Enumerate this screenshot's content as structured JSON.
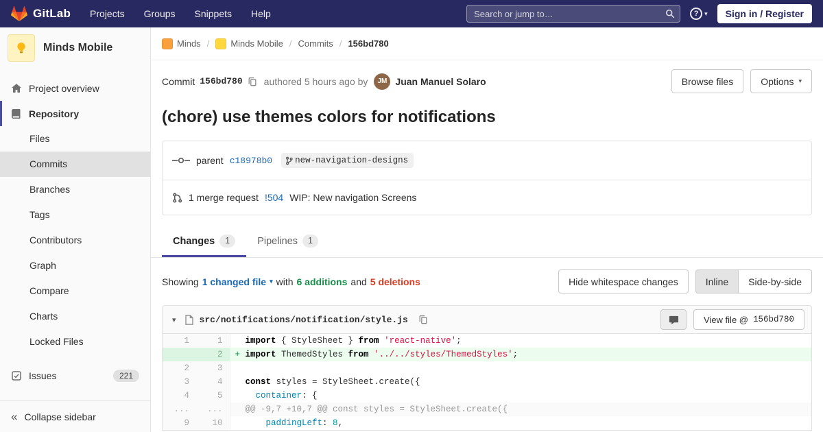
{
  "colors": {
    "navbar_bg": "#292961",
    "accent_indigo": "#4b4ba3",
    "link_blue": "#1b69b6",
    "addition_green": "#168f48",
    "deletion_red": "#db3b21",
    "added_line_bg": "#ecfdf0"
  },
  "navbar": {
    "brand": "GitLab",
    "items": [
      {
        "label": "Projects"
      },
      {
        "label": "Groups"
      },
      {
        "label": "Snippets"
      },
      {
        "label": "Help"
      }
    ],
    "search_placeholder": "Search or jump to…",
    "help_glyph": "?",
    "signin_label": "Sign in / Register"
  },
  "sidebar": {
    "project_name": "Minds Mobile",
    "overview_label": "Project overview",
    "repository_label": "Repository",
    "repo_items": [
      {
        "label": "Files",
        "active": false
      },
      {
        "label": "Commits",
        "active": true
      },
      {
        "label": "Branches",
        "active": false
      },
      {
        "label": "Tags",
        "active": false
      },
      {
        "label": "Contributors",
        "active": false
      },
      {
        "label": "Graph",
        "active": false
      },
      {
        "label": "Compare",
        "active": false
      },
      {
        "label": "Charts",
        "active": false
      },
      {
        "label": "Locked Files",
        "active": false
      }
    ],
    "issues_label": "Issues",
    "issues_count": "221",
    "collapse_label": "Collapse sidebar"
  },
  "breadcrumb": {
    "items": [
      {
        "label": "Minds",
        "avatar": "#f9a03c"
      },
      {
        "label": "Minds Mobile",
        "avatar": "#ffd83d"
      },
      {
        "label": "Commits"
      },
      {
        "label": "156bd780",
        "current": true
      }
    ]
  },
  "commit": {
    "label": "Commit",
    "sha": "156bd780",
    "authored_text": "authored 5 hours ago by",
    "author_initials": "JM",
    "author_name": "Juan Manuel Solaro",
    "browse_files_label": "Browse files",
    "options_label": "Options",
    "title": "(chore) use themes colors for notifications",
    "parent_label": "parent",
    "parent_sha": "c18978b0",
    "branch_name": "new-navigation-designs",
    "mr_count_text": "1 merge request",
    "mr_ref": "!504",
    "mr_title": "WIP: New navigation Screens"
  },
  "tabs": [
    {
      "label": "Changes",
      "count": "1",
      "active": true
    },
    {
      "label": "Pipelines",
      "count": "1",
      "active": false
    }
  ],
  "diff_bar": {
    "showing": "Showing",
    "changed_files": "1 changed file",
    "with_text": "with",
    "additions": "6 additions",
    "and_text": "and",
    "deletions": "5 deletions",
    "hide_whitespace": "Hide whitespace changes",
    "inline": "Inline",
    "side_by_side": "Side-by-side"
  },
  "file": {
    "path": "src/notifications/notification/style.js",
    "view_file_label": "View file @",
    "view_file_sha": "156bd780"
  },
  "diff": {
    "lines": [
      {
        "type": "normal",
        "old": "1",
        "new": "1",
        "sign": "",
        "tokens": [
          [
            "k",
            "import"
          ],
          [
            "p",
            " { StyleSheet } "
          ],
          [
            "k",
            "from"
          ],
          [
            "p",
            " "
          ],
          [
            "s",
            "'react-native'"
          ],
          [
            "p",
            ";"
          ]
        ]
      },
      {
        "type": "add",
        "old": "",
        "new": "2",
        "sign": "+",
        "tokens": [
          [
            "k",
            "import"
          ],
          [
            "p",
            " ThemedStyles "
          ],
          [
            "k",
            "from"
          ],
          [
            "p",
            " "
          ],
          [
            "s",
            "'../../styles/ThemedStyles'"
          ],
          [
            "p",
            ";"
          ]
        ]
      },
      {
        "type": "normal",
        "old": "2",
        "new": "3",
        "sign": "",
        "tokens": []
      },
      {
        "type": "normal",
        "old": "3",
        "new": "4",
        "sign": "",
        "tokens": [
          [
            "k",
            "const"
          ],
          [
            "p",
            " styles = StyleSheet.create({"
          ]
        ]
      },
      {
        "type": "normal",
        "old": "4",
        "new": "5",
        "sign": "",
        "tokens": [
          [
            "p",
            "  "
          ],
          [
            "attr",
            "container"
          ],
          [
            "p",
            ": {"
          ]
        ]
      },
      {
        "type": "match",
        "old": "...",
        "new": "...",
        "sign": "",
        "tokens": [
          [
            "gray",
            "@@ -9,7 +10,7 @@ const styles = StyleSheet.create({"
          ]
        ]
      },
      {
        "type": "normal",
        "old": "9",
        "new": "10",
        "sign": "",
        "tokens": [
          [
            "p",
            "    "
          ],
          [
            "attr",
            "paddingLeft"
          ],
          [
            "p",
            ": "
          ],
          [
            "num",
            "8"
          ],
          [
            "p",
            ","
          ]
        ]
      }
    ]
  }
}
